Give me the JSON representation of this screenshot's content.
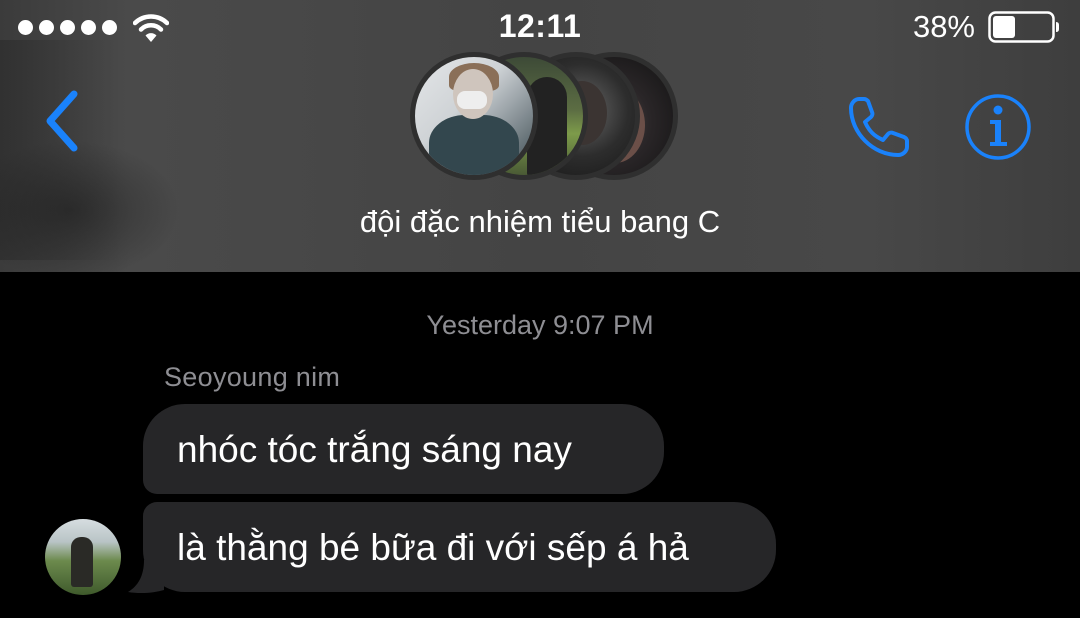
{
  "status_bar": {
    "time": "12:11",
    "battery_percent": "38%",
    "battery_level": 0.38,
    "signal_bars": 5,
    "icons": [
      "signal-dots",
      "wifi-icon",
      "battery-icon"
    ]
  },
  "nav": {
    "group_name": "đội đặc nhiệm tiểu bang C",
    "member_avatar_count": 4,
    "icons": [
      "back-chevron-icon",
      "phone-icon",
      "info-icon"
    ],
    "accent_color": "#1a82fb"
  },
  "conversation": {
    "timestamp": "Yesterday 9:07 PM",
    "sender": "Seoyoung nim",
    "messages": [
      {
        "text": "nhóc tóc trắng sáng nay"
      },
      {
        "text": "là thằng bé bữa đi với sếp á hả"
      }
    ],
    "bubble_color": "#262628"
  }
}
